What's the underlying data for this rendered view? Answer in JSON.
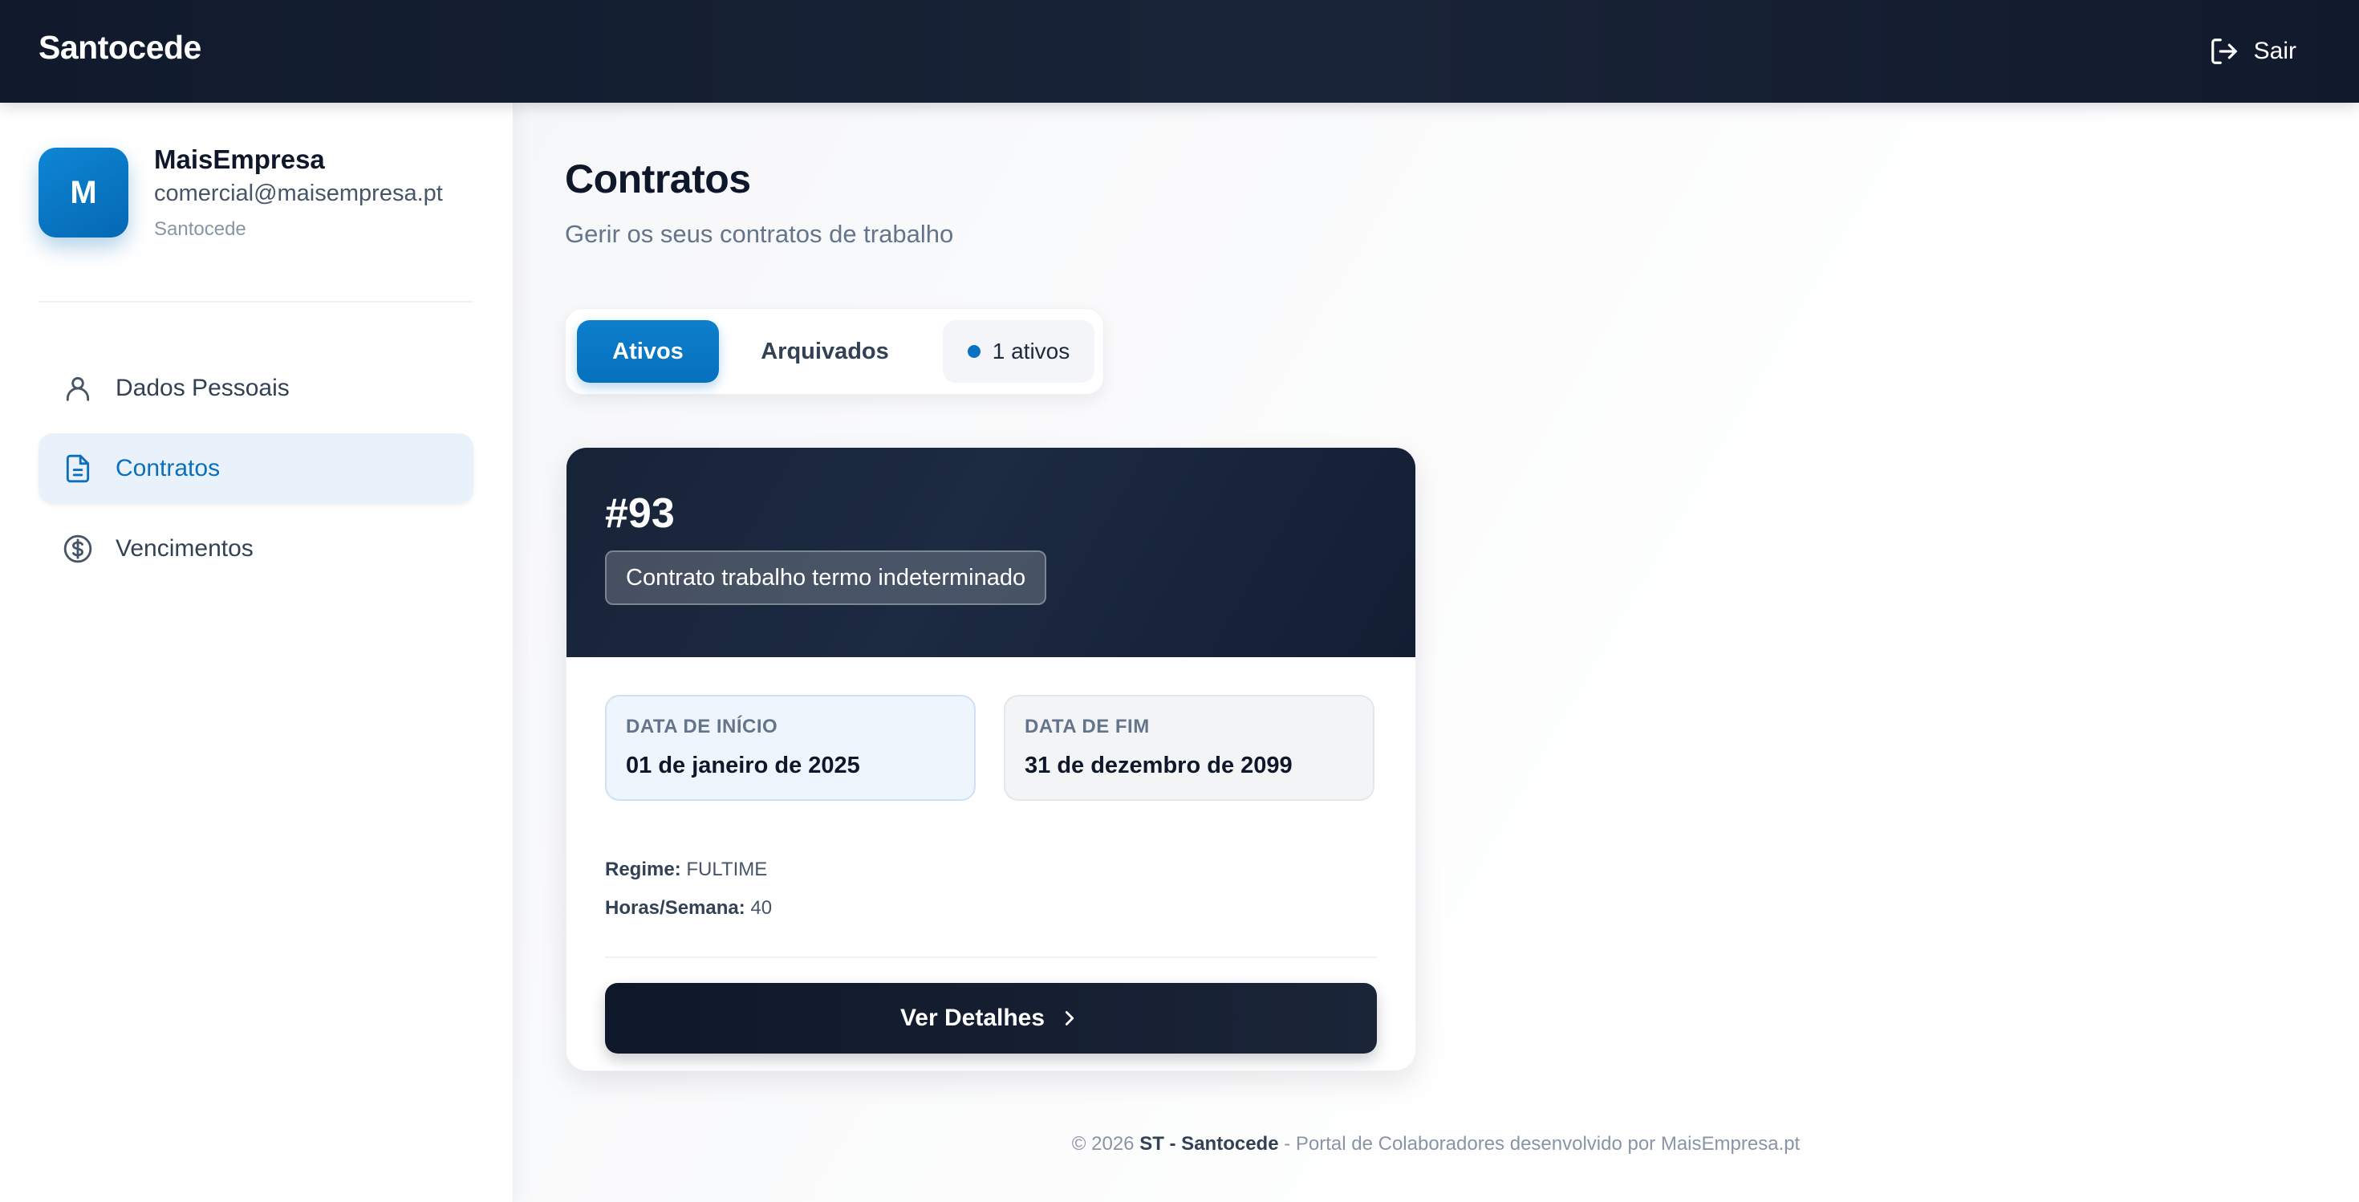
{
  "header": {
    "brand": "Santocede",
    "logout_label": "Sair"
  },
  "user": {
    "initial": "M",
    "name": "MaisEmpresa",
    "email": "comercial@maisempresa.pt",
    "organization": "Santocede"
  },
  "sidebar": {
    "items": [
      {
        "label": "Dados Pessoais",
        "icon": "user-icon",
        "active": false
      },
      {
        "label": "Contratos",
        "icon": "document-icon",
        "active": true
      },
      {
        "label": "Vencimentos",
        "icon": "dollar-circle-icon",
        "active": false
      }
    ]
  },
  "page": {
    "title": "Contratos",
    "subtitle": "Gerir os seus contratos de trabalho"
  },
  "tabs": {
    "active_label": "Ativos",
    "archived_label": "Arquivados",
    "active_count_label": "1 ativos"
  },
  "contract": {
    "id": "#93",
    "type": "Contrato trabalho termo indeterminado",
    "start_label": "DATA DE INÍCIO",
    "start_value": "01 de janeiro de 2025",
    "end_label": "DATA DE FIM",
    "end_value": "31 de dezembro de 2099",
    "regime_label": "Regime:",
    "regime_value": "FULTIME",
    "hours_label": "Horas/Semana:",
    "hours_value": "40",
    "details_button": "Ver Detalhes"
  },
  "footer": {
    "prefix": "© 2026 ",
    "company": "ST - Santocede",
    "suffix": " - Portal de Colaboradores desenvolvido por MaisEmpresa.pt"
  },
  "colors": {
    "accent": "#0a72c2",
    "header_bg": "#111a2c",
    "card_head_bg": "#172337"
  }
}
